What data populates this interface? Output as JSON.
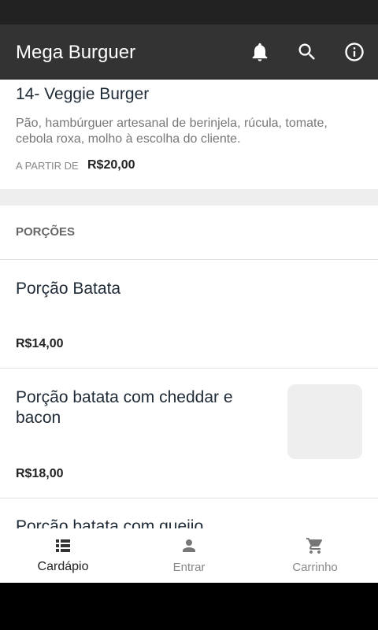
{
  "app": {
    "title": "Mega Burguer"
  },
  "header_icons": [
    "bell-icon",
    "search-icon",
    "info-icon"
  ],
  "featured_item": {
    "title": "14- Veggie Burger",
    "description": "Pão, hambúrguer artesanal de berinjela, rúcula, tomate, cebola roxa, molho à escolha do cliente.",
    "from_label": "A PARTIR DE",
    "price": "R$20,00"
  },
  "section": {
    "title": "PORÇÕES",
    "items": [
      {
        "title": "Porção Batata",
        "price": "R$14,00"
      },
      {
        "title": "Porção batata com cheddar e bacon",
        "price": "R$18,00"
      },
      {
        "title": "Porção batata com queijo"
      }
    ]
  },
  "bottom_nav": [
    {
      "label": "Cardápio",
      "icon": "list-icon",
      "active": true
    },
    {
      "label": "Entrar",
      "icon": "person-icon",
      "active": false
    },
    {
      "label": "Carrinho",
      "icon": "cart-icon",
      "active": false
    }
  ],
  "colors": {
    "appbar": "#333333",
    "section_gap": "#eeeeee",
    "title_text": "#1e2a36"
  }
}
